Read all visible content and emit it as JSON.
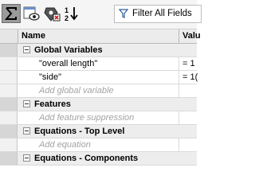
{
  "toolbar": {
    "buttons": [
      {
        "icon": "summation-icon",
        "active": true
      },
      {
        "icon": "eye-view-icon",
        "active": false
      },
      {
        "icon": "suppression-icon",
        "active": false
      },
      {
        "icon": "sort-order-icon",
        "active": false
      }
    ],
    "filter": {
      "icon": "funnel-icon",
      "label": "Filter All Fields"
    }
  },
  "grid": {
    "columns": [
      "Name",
      "Valu"
    ],
    "rows": [
      {
        "type": "group",
        "label": "Global Variables",
        "value": ""
      },
      {
        "type": "var",
        "label": "\"overall length\"",
        "value": "= 1"
      },
      {
        "type": "var",
        "label": "\"side\"",
        "value": "= 1("
      },
      {
        "type": "add",
        "label": "Add global variable",
        "value": ""
      },
      {
        "type": "group",
        "label": "Features",
        "value": ""
      },
      {
        "type": "add",
        "label": "Add feature suppression",
        "value": ""
      },
      {
        "type": "group",
        "label": "Equations - Top Level",
        "value": ""
      },
      {
        "type": "add",
        "label": "Add equation",
        "value": ""
      },
      {
        "type": "group",
        "label": "Equations - Components",
        "value": ""
      }
    ]
  }
}
